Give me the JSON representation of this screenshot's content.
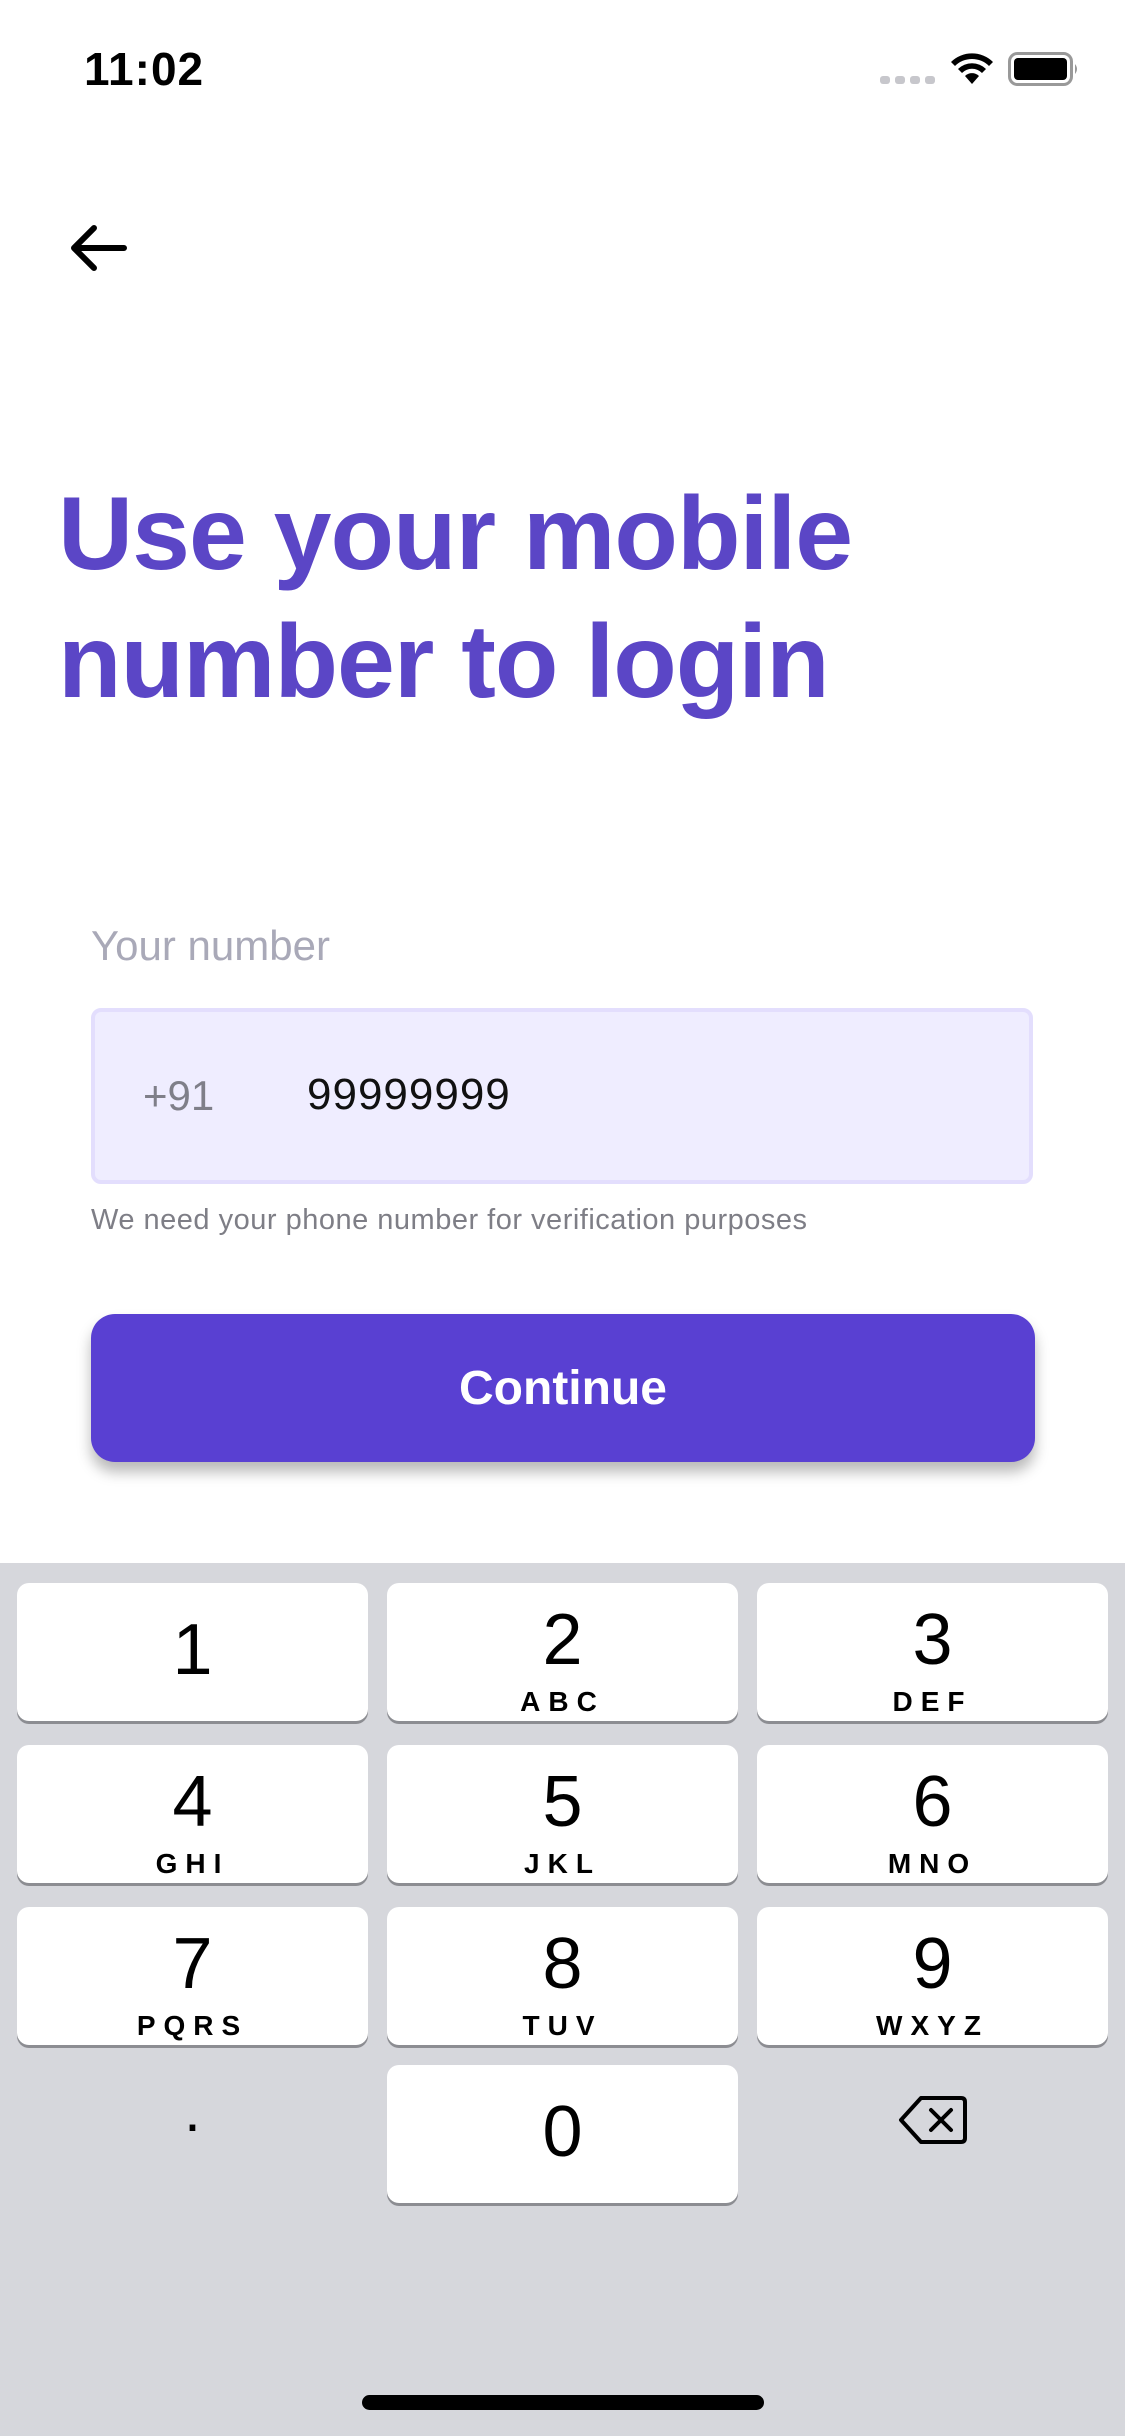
{
  "status_bar": {
    "time": "11:02"
  },
  "header": {
    "title_line1": "Use your mobile",
    "title_line2": "number to login"
  },
  "form": {
    "label": "Your number",
    "country_code": "+91",
    "phone_value": "99999999",
    "helper": "We need your phone number for verification purposes",
    "continue_label": "Continue"
  },
  "keyboard": {
    "keys": [
      {
        "digit": "1",
        "letters": ""
      },
      {
        "digit": "2",
        "letters": "ABC"
      },
      {
        "digit": "3",
        "letters": "DEF"
      },
      {
        "digit": "4",
        "letters": "GHI"
      },
      {
        "digit": "5",
        "letters": "JKL"
      },
      {
        "digit": "6",
        "letters": "MNO"
      },
      {
        "digit": "7",
        "letters": "PQRS"
      },
      {
        "digit": "8",
        "letters": "TUV"
      },
      {
        "digit": "9",
        "letters": "WXYZ"
      },
      {
        "digit": "0",
        "letters": ""
      }
    ],
    "dot": "."
  },
  "colors": {
    "accent": "#5940d2",
    "title": "#5b46c6",
    "field_bg": "#efedff"
  }
}
